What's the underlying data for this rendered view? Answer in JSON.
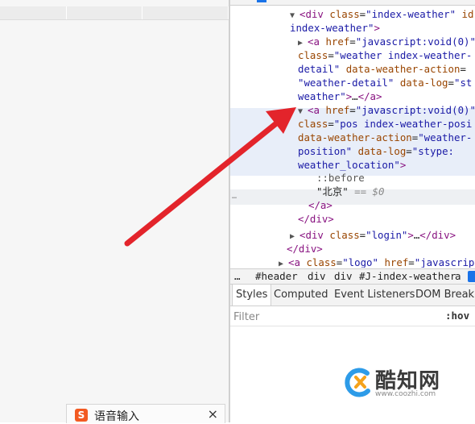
{
  "elements_tree": {
    "lines": [
      {
        "parts": [
          [
            "tri",
            "▼ "
          ],
          [
            "tag",
            "<div "
          ],
          [
            "attr",
            "class"
          ],
          [
            "txt",
            "="
          ],
          [
            "val",
            "\"index-weather\""
          ],
          [
            "txt",
            " "
          ],
          [
            "attr",
            "id"
          ]
        ]
      },
      {
        "parts": [
          [
            "val",
            "index-weather\""
          ],
          [
            "tag",
            ">"
          ]
        ]
      },
      {
        "parts": [
          [
            "tri",
            "▶ "
          ],
          [
            "tag",
            "<a "
          ],
          [
            "attr",
            "href"
          ],
          [
            "txt",
            "="
          ],
          [
            "val",
            "\"javascript:void(0)\""
          ]
        ]
      },
      {
        "parts": [
          [
            "attr",
            "class"
          ],
          [
            "txt",
            "="
          ],
          [
            "val",
            "\"weather index-weather-"
          ]
        ]
      },
      {
        "parts": [
          [
            "val",
            "detail\""
          ],
          [
            "txt",
            " "
          ],
          [
            "attr",
            "data-weather-action"
          ],
          [
            "txt",
            "="
          ]
        ]
      },
      {
        "parts": [
          [
            "val",
            "\"weather-detail\""
          ],
          [
            "txt",
            " "
          ],
          [
            "attr",
            "data-log"
          ],
          [
            "txt",
            "="
          ],
          [
            "val",
            "\"st"
          ]
        ]
      },
      {
        "parts": [
          [
            "val",
            "weather\""
          ],
          [
            "tag",
            ">"
          ],
          [
            "txt",
            "…"
          ],
          [
            "tag",
            "</a>"
          ]
        ]
      },
      {
        "parts": [
          [
            "tri",
            "▼ "
          ],
          [
            "tag",
            "<a "
          ],
          [
            "attr",
            "href"
          ],
          [
            "txt",
            "="
          ],
          [
            "val",
            "\"javascript:void(0)\""
          ]
        ]
      },
      {
        "parts": [
          [
            "attr",
            "class"
          ],
          [
            "txt",
            "="
          ],
          [
            "val",
            "\"pos index-weather-posi"
          ]
        ]
      },
      {
        "parts": [
          [
            "attr",
            "data-weather-action"
          ],
          [
            "txt",
            "="
          ],
          [
            "val",
            "\"weather-"
          ]
        ]
      },
      {
        "parts": [
          [
            "val",
            "position\""
          ],
          [
            "txt",
            " "
          ],
          [
            "attr",
            "data-log"
          ],
          [
            "txt",
            "="
          ],
          [
            "val",
            "\"stype:"
          ]
        ]
      },
      {
        "parts": [
          [
            "val",
            "weather_location\""
          ],
          [
            "tag",
            ">"
          ]
        ]
      },
      {
        "parts": [
          [
            "pseudo",
            "::before"
          ]
        ]
      },
      {
        "parts": [
          [
            "txt",
            "\"北京\""
          ],
          [
            "txt",
            " "
          ],
          [
            "dim",
            "== $0"
          ]
        ]
      },
      {
        "parts": [
          [
            "tag",
            "</a>"
          ]
        ]
      },
      {
        "parts": [
          [
            "tag",
            "</div>"
          ]
        ]
      },
      {
        "parts": [
          [
            "tri",
            "▶ "
          ],
          [
            "tag",
            "<div "
          ],
          [
            "attr",
            "class"
          ],
          [
            "txt",
            "="
          ],
          [
            "val",
            "\"login\""
          ],
          [
            "tag",
            ">"
          ],
          [
            "txt",
            "…"
          ],
          [
            "tag",
            "</div>"
          ]
        ]
      },
      {
        "parts": [
          [
            "tag",
            "</div>"
          ]
        ]
      },
      {
        "parts": [
          [
            "tri",
            "▶ "
          ],
          [
            "tag",
            "<a "
          ],
          [
            "attr",
            "class"
          ],
          [
            "txt",
            "="
          ],
          [
            "val",
            "\"logo\""
          ],
          [
            "txt",
            " "
          ],
          [
            "attr",
            "href"
          ],
          [
            "txt",
            "="
          ],
          [
            "val",
            "\"javascrip"
          ]
        ]
      }
    ],
    "ellipsis": "…"
  },
  "breadcrumb": [
    "…",
    "#header",
    "div",
    "div",
    "#J-index-weather",
    "a"
  ],
  "subtabs": [
    "Styles",
    "Computed",
    "Event Listeners",
    "DOM Breakp"
  ],
  "filter": {
    "placeholder": "Filter",
    "hov": ":hov"
  },
  "ime": {
    "label": "语音输入",
    "logo": "S",
    "close": "×"
  },
  "watermark": {
    "name": "酷知网",
    "url": "www.coozhi.com"
  },
  "colors": {
    "arrow": "#e3242b",
    "selection": "#e8eef9",
    "accent": "#1a73e8"
  }
}
